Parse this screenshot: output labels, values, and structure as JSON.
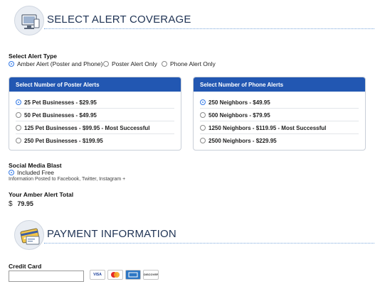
{
  "coverage": {
    "title": "SELECT ALERT COVERAGE",
    "icon": "computer-monitor-icon"
  },
  "alert_type": {
    "label": "Select Alert Type",
    "options": [
      "Amber Alert (Poster and Phone)",
      "Poster Alert Only",
      "Phone Alert Only"
    ],
    "selected": "Amber Alert (Poster and Phone)"
  },
  "poster_panel": {
    "header": "Select Number of Poster Alerts",
    "options": [
      "25 Pet Businesses - $29.95",
      "50 Pet Businesses - $49.95",
      "125 Pet Businesses - $99.95 - Most Successful",
      "250 Pet Businesses - $199.95"
    ],
    "selected_index": 0
  },
  "phone_panel": {
    "header": "Select Number of Phone Alerts",
    "options": [
      "250 Neighbors - $49.95",
      "500 Neighbors - $79.95",
      "1250 Neighbors - $119.95 - Most Successful",
      "2500 Neighbors - $229.95"
    ],
    "selected_index": 0
  },
  "social": {
    "label": "Social Media Blast",
    "option": "Included Free",
    "note": "Information Posted to Facebook, Twitter, Instagram +"
  },
  "total": {
    "label": "Your Amber Alert Total",
    "currency": "$",
    "amount": "79.95"
  },
  "payment": {
    "title": "PAYMENT INFORMATION",
    "icon": "credit-card-icon"
  },
  "credit_card": {
    "label": "Credit Card",
    "value": "",
    "cards": [
      "VISA",
      "MasterCard",
      "AMEX",
      "DISCOVER"
    ]
  },
  "colors": {
    "accent": "#2257b2",
    "title": "#1f3354",
    "divider": "#7aa7dd",
    "radio_selected": "#4a8df0"
  }
}
